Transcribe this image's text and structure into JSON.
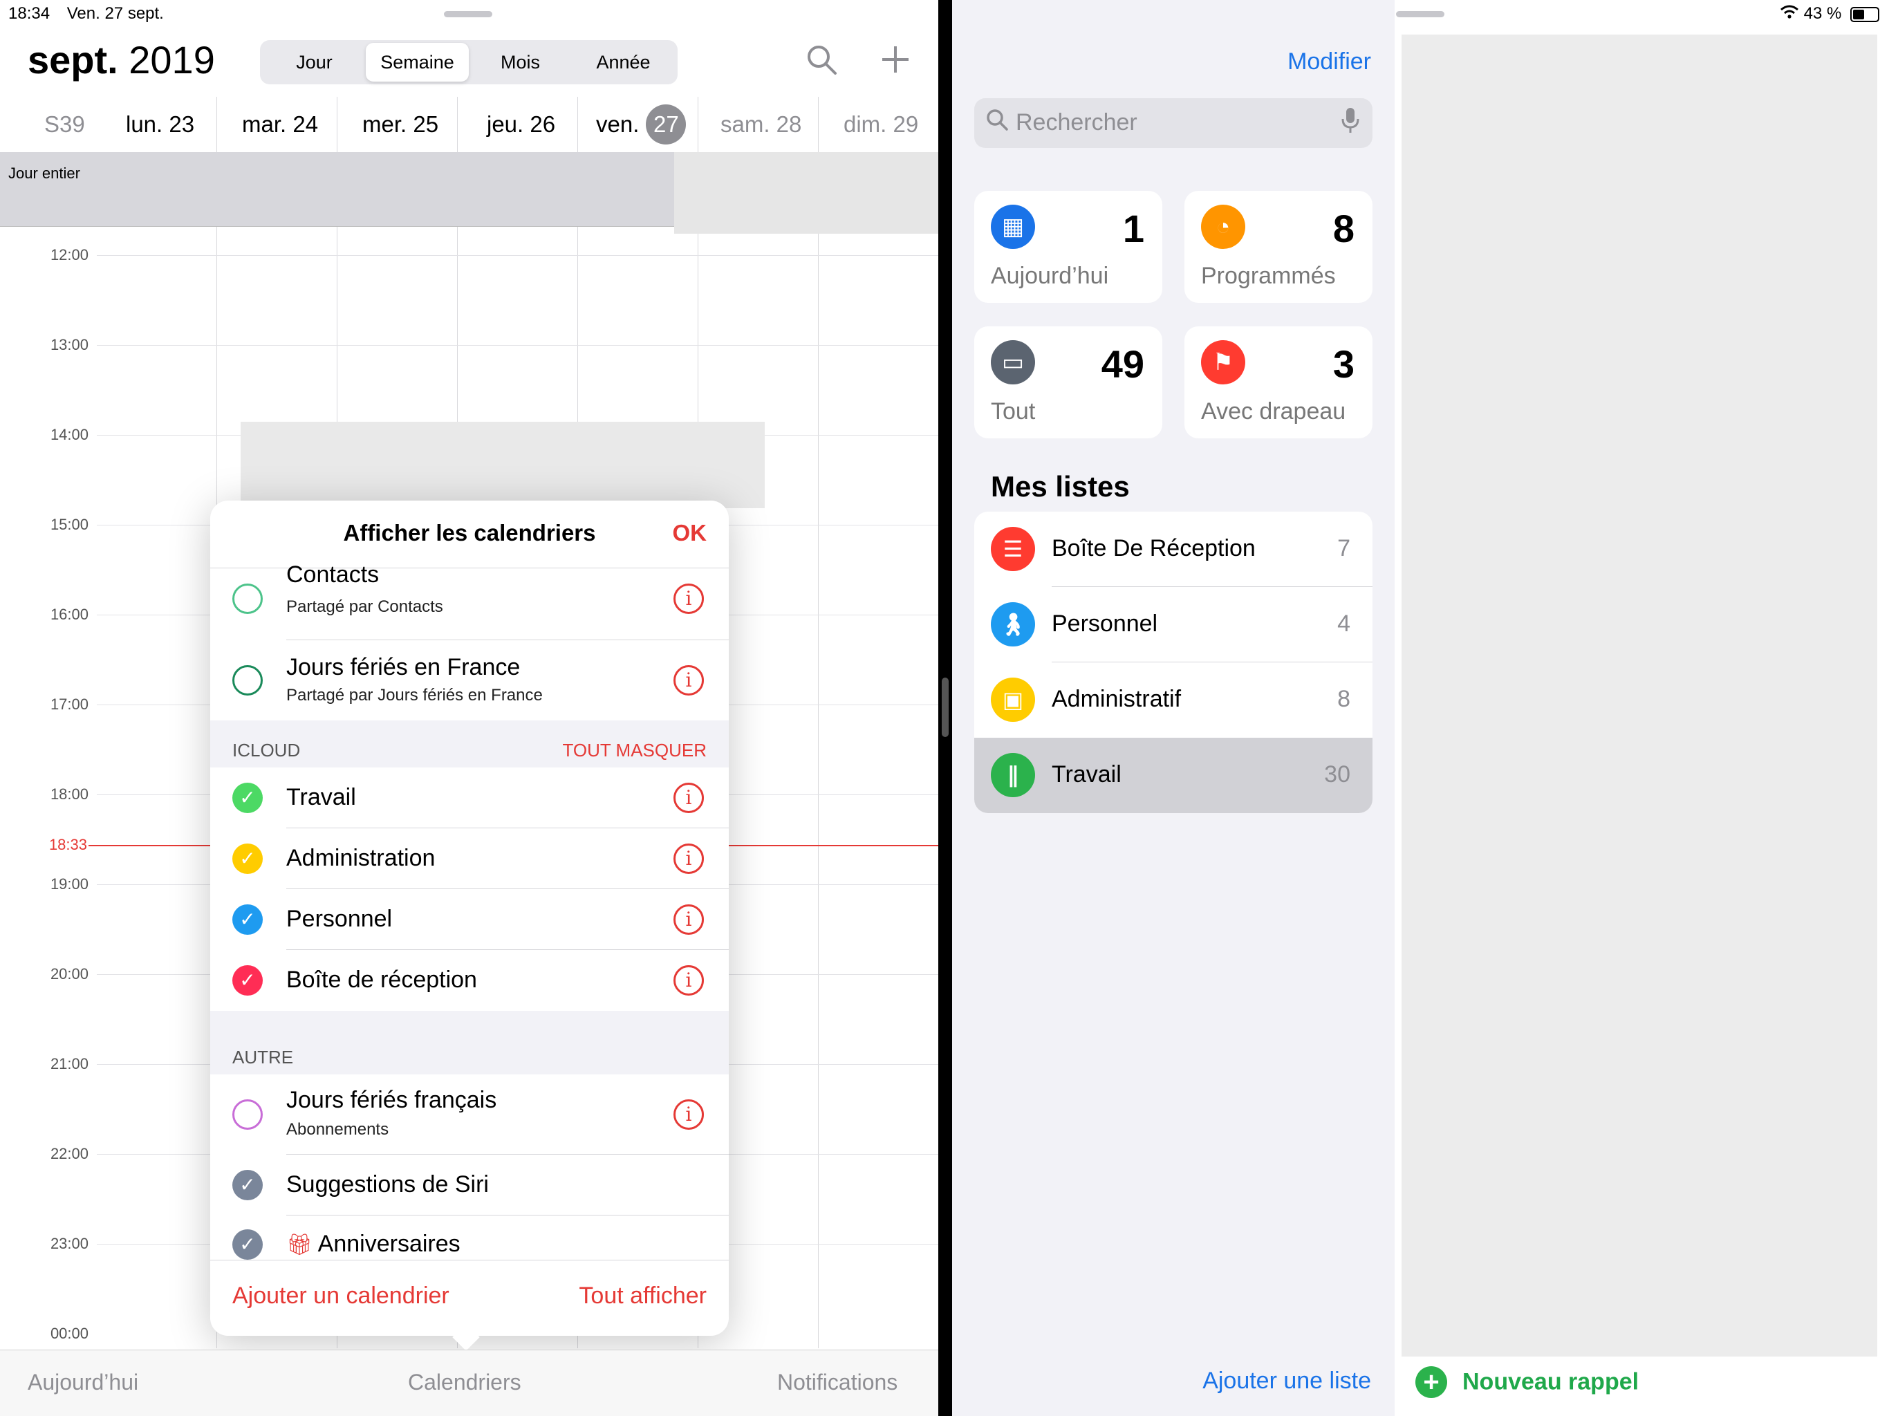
{
  "calendar": {
    "status_time": "18:34",
    "status_date": "Ven. 27 sept.",
    "title_month": "sept.",
    "title_year": "2019",
    "views": [
      "Jour",
      "Semaine",
      "Mois",
      "Année"
    ],
    "active_view": "Semaine",
    "week_label": "S39",
    "days": [
      {
        "label": "lun. 23"
      },
      {
        "label": "mar. 24"
      },
      {
        "label": "mer. 25"
      },
      {
        "label": "jeu. 26"
      },
      {
        "label": "ven.",
        "badge": "27"
      },
      {
        "label": "sam. 28"
      },
      {
        "label": "dim. 29"
      }
    ],
    "all_day_label": "Jour entier",
    "hours": [
      "12:00",
      "13:00",
      "14:00",
      "15:00",
      "16:00",
      "17:00",
      "18:00",
      "19:00",
      "20:00",
      "21:00",
      "22:00",
      "23:00",
      "00:00"
    ],
    "now_label": "18:33",
    "tabbar": {
      "today": "Aujourd’hui",
      "calendars": "Calendriers",
      "notifications": "Notifications"
    },
    "popover": {
      "title": "Afficher les calendriers",
      "ok": "OK",
      "top_rows": [
        {
          "name": "Contacts",
          "sub": "Partagé par Contacts",
          "color": "#4cc38a",
          "checked": false
        },
        {
          "name": "Jours fériés en France",
          "sub": "Partagé par Jours fériés en France",
          "color": "#1a8a5a",
          "checked": false
        }
      ],
      "icloud_label": "ICLOUD",
      "hide_all": "TOUT MASQUER",
      "icloud_rows": [
        {
          "name": "Travail",
          "color": "#4cd964"
        },
        {
          "name": "Administration",
          "color": "#ffcc00"
        },
        {
          "name": "Personnel",
          "color": "#1e9bf0"
        },
        {
          "name": "Boîte de réception",
          "color": "#ff2d55"
        }
      ],
      "other_label": "AUTRE",
      "other_rows": [
        {
          "name": "Jours fériés français",
          "sub": "Abonnements",
          "color": "#c86dd7",
          "checked": false
        },
        {
          "name": "Suggestions de Siri",
          "color": "#7a869a",
          "checked": true
        },
        {
          "name": "Anniversaires",
          "color": "#7a869a",
          "checked": true,
          "gift": true
        }
      ],
      "add_calendar": "Ajouter un calendrier",
      "show_all": "Tout afficher"
    }
  },
  "reminders": {
    "edit": "Modifier",
    "search_placeholder": "Rechercher",
    "cards": [
      {
        "label": "Aujourd’hui",
        "count": "1",
        "color": "#1a73e8",
        "icon": "calendar-icon"
      },
      {
        "label": "Programmés",
        "count": "8",
        "color": "#ff9500",
        "icon": "clock-icon"
      },
      {
        "label": "Tout",
        "count": "49",
        "color": "#5b6470",
        "icon": "tray-icon"
      },
      {
        "label": "Avec drapeau",
        "count": "3",
        "color": "#ff3b30",
        "icon": "flag-icon"
      }
    ],
    "my_lists_title": "Mes listes",
    "lists": [
      {
        "name": "Boîte De Réception",
        "count": "7",
        "color": "#ff3b30",
        "icon": "list-icon"
      },
      {
        "name": "Personnel",
        "count": "4",
        "color": "#1e9bf0",
        "icon": "person-icon"
      },
      {
        "name": "Administratif",
        "count": "8",
        "color": "#ffcc00",
        "icon": "money-icon"
      },
      {
        "name": "Travail",
        "count": "30",
        "color": "#2bb24c",
        "icon": "tools-icon",
        "selected": true
      }
    ],
    "add_list": "Ajouter une liste"
  },
  "detail": {
    "battery": "43 %",
    "new_reminder": "Nouveau rappel"
  }
}
